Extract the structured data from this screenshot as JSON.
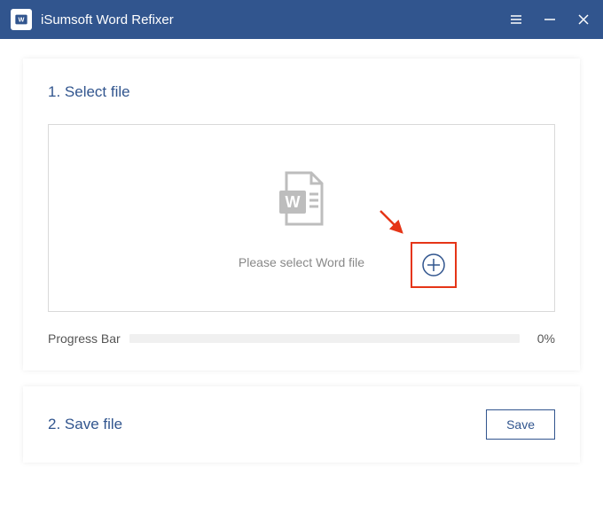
{
  "titlebar": {
    "app_title": "iSumsoft Word Refixer"
  },
  "section1": {
    "title": "1. Select file",
    "drop_text": "Please select Word file",
    "progress_label": "Progress Bar",
    "progress_percent": "0%"
  },
  "section2": {
    "title": "2. Save file",
    "save_button": "Save"
  }
}
